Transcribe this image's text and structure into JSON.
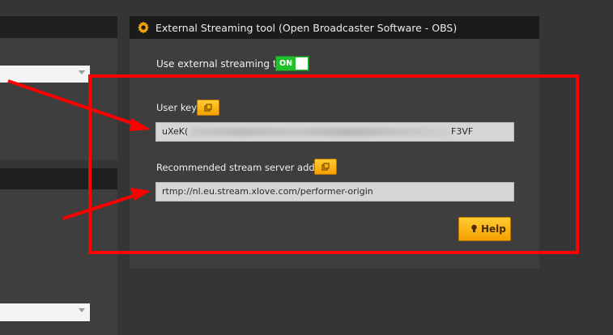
{
  "panel": {
    "title": "External Streaming tool (Open Broadcaster Software - OBS)",
    "toggle_label": "Use external streaming tool",
    "toggle_state": "ON",
    "user_key_label": "User key:",
    "user_key_start": "uXeK(",
    "user_key_end": "F3VF",
    "server_label": "Recommended stream server address:",
    "server_value": "rtmp://nl.eu.stream.xlove.com/performer-origin",
    "help_label": "Help"
  },
  "colors": {
    "accent_orange": "#f7a000",
    "toggle_green": "#22c12b",
    "annotation_red": "#ff0000"
  },
  "icons": {
    "header": "gear-icon",
    "copy": "copy-icon",
    "help": "lightbulb-icon"
  }
}
